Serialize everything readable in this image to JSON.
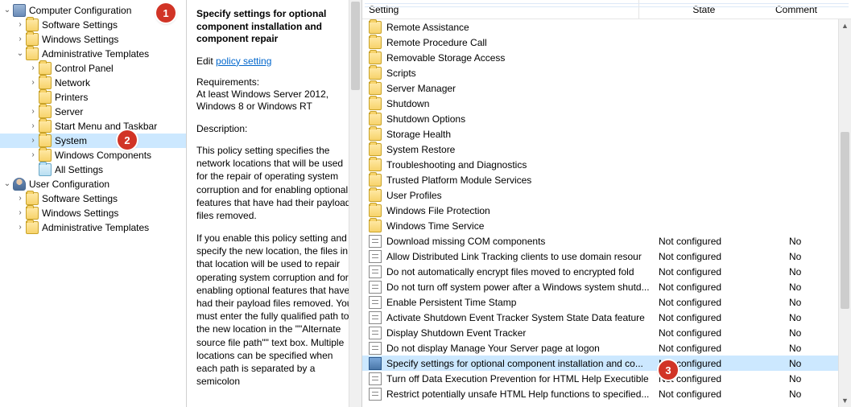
{
  "badges": [
    "1",
    "2",
    "3"
  ],
  "tree": {
    "computer_cfg": "Computer Configuration",
    "cc_software": "Software Settings",
    "cc_windows": "Windows Settings",
    "cc_admin": "Administrative Templates",
    "cc_control_panel": "Control Panel",
    "cc_network": "Network",
    "cc_printers": "Printers",
    "cc_server": "Server",
    "cc_start_menu": "Start Menu and Taskbar",
    "cc_system": "System",
    "cc_win_comp": "Windows Components",
    "cc_all": "All Settings",
    "user_cfg": "User Configuration",
    "uc_software": "Software Settings",
    "uc_windows": "Windows Settings",
    "uc_admin": "Administrative Templates"
  },
  "desc": {
    "title": "Specify settings for optional component installation and component repair",
    "edit_prefix": "Edit ",
    "edit_link": "policy setting ",
    "req_h": "Requirements:",
    "req_v": "At least Windows Server 2012, Windows 8 or Windows RT",
    "desc_h": "Description:",
    "p1": "This policy setting specifies the network locations that will be used for the repair of operating system corruption and for enabling optional features that have had their payload files removed.",
    "p2": "If you enable this policy setting and specify the new location, the files in that location will be used to repair operating system corruption and for enabling optional features that have had their payload files removed. You must enter the fully qualified path to the new location in the \"\"Alternate source file path\"\" text box. Multiple locations can be specified when each path is separated by a semicolon"
  },
  "cols": {
    "setting": "Setting",
    "state": "State",
    "comment": "Comment"
  },
  "rows": [
    {
      "t": "folder",
      "name": "Remote Assistance"
    },
    {
      "t": "folder",
      "name": "Remote Procedure Call"
    },
    {
      "t": "folder",
      "name": "Removable Storage Access"
    },
    {
      "t": "folder",
      "name": "Scripts"
    },
    {
      "t": "folder",
      "name": "Server Manager"
    },
    {
      "t": "folder",
      "name": "Shutdown"
    },
    {
      "t": "folder",
      "name": "Shutdown Options"
    },
    {
      "t": "folder",
      "name": "Storage Health"
    },
    {
      "t": "folder",
      "name": "System Restore"
    },
    {
      "t": "folder",
      "name": "Troubleshooting and Diagnostics"
    },
    {
      "t": "folder",
      "name": "Trusted Platform Module Services"
    },
    {
      "t": "folder",
      "name": "User Profiles"
    },
    {
      "t": "folder",
      "name": "Windows File Protection"
    },
    {
      "t": "folder",
      "name": "Windows Time Service"
    },
    {
      "t": "setting",
      "name": "Download missing COM components",
      "state": "Not configured",
      "comment": "No"
    },
    {
      "t": "setting",
      "name": "Allow Distributed Link Tracking clients to use domain resour",
      "state": "Not configured",
      "comment": "No"
    },
    {
      "t": "setting",
      "name": "Do not automatically encrypt files moved to encrypted fold",
      "state": "Not configured",
      "comment": "No"
    },
    {
      "t": "setting",
      "name": "Do not turn off system power after a Windows system shutd...",
      "state": "Not configured",
      "comment": "No"
    },
    {
      "t": "setting",
      "name": "Enable Persistent Time Stamp",
      "state": "Not configured",
      "comment": "No"
    },
    {
      "t": "setting",
      "name": "Activate Shutdown Event Tracker System State Data feature",
      "state": "Not configured",
      "comment": "No"
    },
    {
      "t": "setting",
      "name": "Display Shutdown Event Tracker",
      "state": "Not configured",
      "comment": "No"
    },
    {
      "t": "setting",
      "name": "Do not display Manage Your Server page at logon",
      "state": "Not configured",
      "comment": "No"
    },
    {
      "t": "setting",
      "name": "Specify settings for optional component installation and co...",
      "state": "Not configured",
      "comment": "No",
      "sel": true
    },
    {
      "t": "setting",
      "name": "Turn off Data Execution Prevention for HTML Help Executible",
      "state": "Not configured",
      "comment": "No"
    },
    {
      "t": "setting",
      "name": "Restrict potentially unsafe HTML Help functions to specified...",
      "state": "Not configured",
      "comment": "No"
    }
  ]
}
